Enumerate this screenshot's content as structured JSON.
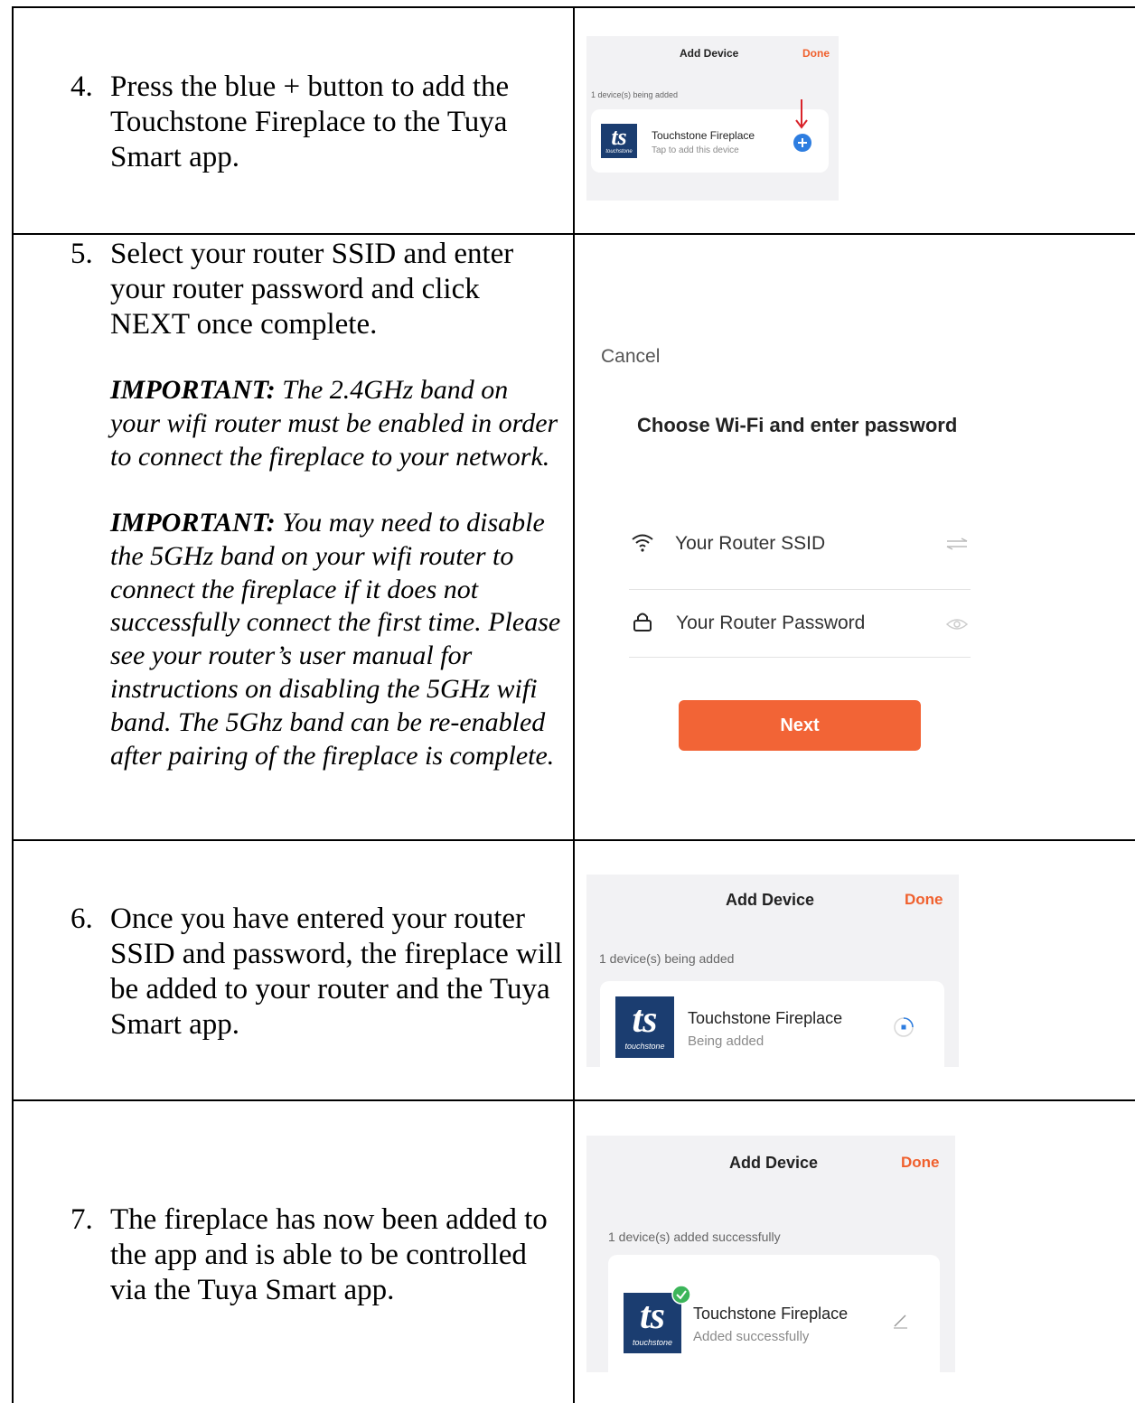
{
  "steps": [
    {
      "number": "4.",
      "text": "Press the blue + button to add the Touchstone Fireplace to the Tuya Smart app."
    },
    {
      "number": "5.",
      "text": "Select your router SSID and enter your router password and click NEXT once complete.",
      "notes": [
        {
          "label": "IMPORTANT:",
          "text": " The 2.4GHz band on your wifi router must be enabled in order to connect the fireplace to your network."
        },
        {
          "label": "IMPORTANT:",
          "text": " You may need to disable the 5GHz band on your wifi router to connect the fireplace if it does not successfully connect the first time.  Please see your router’s user manual for instructions on disabling the 5GHz wifi band.  The 5Ghz band can be re-enabled after pairing of the fireplace is complete."
        }
      ]
    },
    {
      "number": "6.",
      "text": "Once you have entered your router SSID and password, the fireplace will be added to your router and the Tuya Smart app."
    },
    {
      "number": "7.",
      "text": "The fireplace has now been added to the app and is able to be controlled via the Tuya Smart app."
    }
  ],
  "screens": {
    "add_device_1": {
      "title": "Add Device",
      "done": "Done",
      "subtitle": "1 device(s) being added",
      "logo_text": "ts",
      "logo_brand": "touchstone",
      "device_name": "Touchstone Fireplace",
      "device_status": "Tap to add this device"
    },
    "wifi": {
      "cancel": "Cancel",
      "heading": "Choose Wi-Fi and enter password",
      "ssid": "Your Router SSID",
      "password": "Your Router Password",
      "next": "Next"
    },
    "add_device_2": {
      "title": "Add Device",
      "done": "Done",
      "subtitle": "1 device(s) being added",
      "logo_text": "ts",
      "logo_brand": "touchstone",
      "device_name": "Touchstone Fireplace",
      "device_status": "Being added"
    },
    "add_device_3": {
      "title": "Add Device",
      "done": "Done",
      "subtitle": "1 device(s) added successfully",
      "logo_text": "ts",
      "logo_brand": "touchstone",
      "device_name": "Touchstone Fireplace",
      "device_status": "Added successfully"
    }
  },
  "colors": {
    "accent_orange": "#f26436",
    "plus_blue": "#2d7de0",
    "logo_navy": "#1b3d70",
    "arrow_red": "#d9232a",
    "check_green": "#3cb55a"
  }
}
